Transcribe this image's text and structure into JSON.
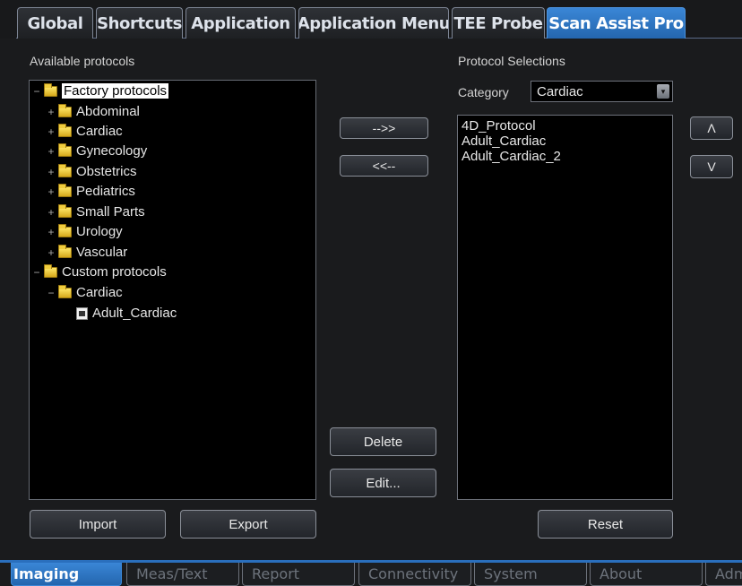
{
  "top_tabs": [
    {
      "label": "Global"
    },
    {
      "label": "Shortcuts"
    },
    {
      "label": "Application"
    },
    {
      "label": "Application Menu"
    },
    {
      "label": "TEE Probe"
    },
    {
      "label": "Scan Assist Pro",
      "active": true
    }
  ],
  "left_panel": {
    "title": "Available protocols",
    "tree": [
      {
        "expander": "−",
        "icon": "folder",
        "label": "Factory protocols",
        "selected": true
      },
      {
        "expander": "+",
        "icon": "folder",
        "label": "Abdominal"
      },
      {
        "expander": "+",
        "icon": "folder",
        "label": "Cardiac"
      },
      {
        "expander": "+",
        "icon": "folder",
        "label": "Gynecology"
      },
      {
        "expander": "+",
        "icon": "folder",
        "label": "Obstetrics"
      },
      {
        "expander": "+",
        "icon": "folder",
        "label": "Pediatrics"
      },
      {
        "expander": "+",
        "icon": "folder",
        "label": "Small Parts"
      },
      {
        "expander": "+",
        "icon": "folder",
        "label": "Urology"
      },
      {
        "expander": "+",
        "icon": "folder",
        "label": "Vascular"
      },
      {
        "expander": "−",
        "icon": "folder",
        "label": "Custom protocols"
      },
      {
        "expander": "−",
        "icon": "folder",
        "label": "Cardiac"
      },
      {
        "expander": "",
        "icon": "document",
        "label": "Adult_Cardiac"
      }
    ],
    "import_label": "Import",
    "export_label": "Export"
  },
  "middle_buttons": {
    "add_label": "-->>",
    "remove_label": "<<--",
    "delete_label": "Delete",
    "edit_label": "Edit..."
  },
  "right_panel": {
    "title": "Protocol Selections",
    "category_label": "Category",
    "category_value": "Cardiac",
    "selections": [
      "4D_Protocol",
      "Adult_Cardiac",
      "Adult_Cardiac_2"
    ],
    "move_up_label": "Λ",
    "move_down_label": "V",
    "reset_label": "Reset"
  },
  "bottom_tabs": [
    {
      "label": "Imaging",
      "active": true
    },
    {
      "label": "Meas/Text"
    },
    {
      "label": "Report"
    },
    {
      "label": "Connectivity"
    },
    {
      "label": "System"
    },
    {
      "label": "About"
    },
    {
      "label": "Adm"
    }
  ],
  "colors": {
    "accent_blue": "#2f79c9",
    "background": "#1a1b1d",
    "folder_yellow": "#f0cd3e"
  }
}
